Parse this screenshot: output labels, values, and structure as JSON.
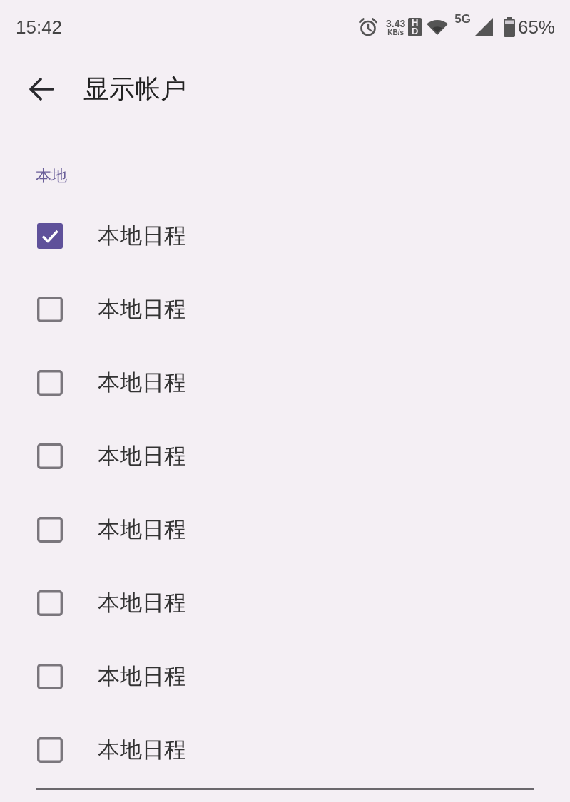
{
  "status_bar": {
    "time": "15:42",
    "speed": "3.43",
    "speed_unit": "KB/s",
    "hd_badge": "HD",
    "network": "5G",
    "battery": "65%"
  },
  "toolbar": {
    "title": "显示帐户"
  },
  "sections": [
    {
      "header": "本地",
      "items": [
        {
          "label": "本地日程",
          "checked": true
        },
        {
          "label": "本地日程",
          "checked": false
        },
        {
          "label": "本地日程",
          "checked": false
        },
        {
          "label": "本地日程",
          "checked": false
        },
        {
          "label": "本地日程",
          "checked": false
        },
        {
          "label": "本地日程",
          "checked": false
        },
        {
          "label": "本地日程",
          "checked": false
        },
        {
          "label": "本地日程",
          "checked": false
        }
      ]
    }
  ]
}
